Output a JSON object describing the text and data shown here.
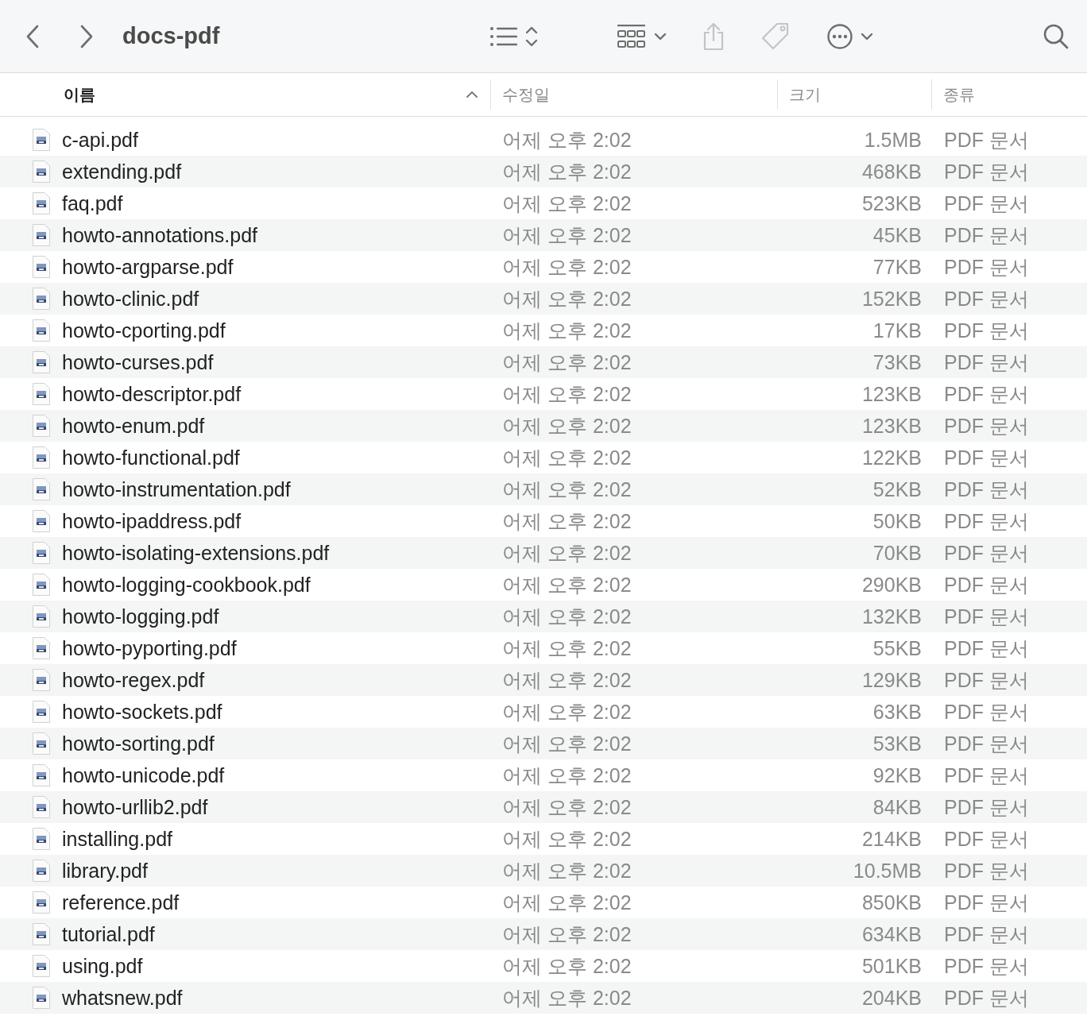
{
  "toolbar": {
    "title": "docs-pdf",
    "buttons": [
      {
        "kind": "back",
        "disabled": false
      },
      {
        "kind": "forward",
        "disabled": false
      },
      {
        "kind": "group",
        "disabled": false
      },
      {
        "kind": "view",
        "disabled": false
      },
      {
        "kind": "share",
        "disabled": true
      },
      {
        "kind": "tag",
        "disabled": true
      },
      {
        "kind": "more",
        "disabled": false
      },
      {
        "kind": "search",
        "disabled": false
      }
    ]
  },
  "table": {
    "columns": [
      {
        "label": "이름",
        "sorted": true
      },
      {
        "label": "수정일",
        "sorted": false
      },
      {
        "label": "크기",
        "sorted": false
      },
      {
        "label": "종류",
        "sorted": false
      }
    ],
    "rows": [
      {
        "name": "c-api.pdf",
        "modified": "어제 오후 2:02",
        "size": "1.5MB",
        "kind": "PDF 문서"
      },
      {
        "name": "extending.pdf",
        "modified": "어제 오후 2:02",
        "size": "468KB",
        "kind": "PDF 문서"
      },
      {
        "name": "faq.pdf",
        "modified": "어제 오후 2:02",
        "size": "523KB",
        "kind": "PDF 문서"
      },
      {
        "name": "howto-annotations.pdf",
        "modified": "어제 오후 2:02",
        "size": "45KB",
        "kind": "PDF 문서"
      },
      {
        "name": "howto-argparse.pdf",
        "modified": "어제 오후 2:02",
        "size": "77KB",
        "kind": "PDF 문서"
      },
      {
        "name": "howto-clinic.pdf",
        "modified": "어제 오후 2:02",
        "size": "152KB",
        "kind": "PDF 문서"
      },
      {
        "name": "howto-cporting.pdf",
        "modified": "어제 오후 2:02",
        "size": "17KB",
        "kind": "PDF 문서"
      },
      {
        "name": "howto-curses.pdf",
        "modified": "어제 오후 2:02",
        "size": "73KB",
        "kind": "PDF 문서"
      },
      {
        "name": "howto-descriptor.pdf",
        "modified": "어제 오후 2:02",
        "size": "123KB",
        "kind": "PDF 문서"
      },
      {
        "name": "howto-enum.pdf",
        "modified": "어제 오후 2:02",
        "size": "123KB",
        "kind": "PDF 문서"
      },
      {
        "name": "howto-functional.pdf",
        "modified": "어제 오후 2:02",
        "size": "122KB",
        "kind": "PDF 문서"
      },
      {
        "name": "howto-instrumentation.pdf",
        "modified": "어제 오후 2:02",
        "size": "52KB",
        "kind": "PDF 문서"
      },
      {
        "name": "howto-ipaddress.pdf",
        "modified": "어제 오후 2:02",
        "size": "50KB",
        "kind": "PDF 문서"
      },
      {
        "name": "howto-isolating-extensions.pdf",
        "modified": "어제 오후 2:02",
        "size": "70KB",
        "kind": "PDF 문서"
      },
      {
        "name": "howto-logging-cookbook.pdf",
        "modified": "어제 오후 2:02",
        "size": "290KB",
        "kind": "PDF 문서"
      },
      {
        "name": "howto-logging.pdf",
        "modified": "어제 오후 2:02",
        "size": "132KB",
        "kind": "PDF 문서"
      },
      {
        "name": "howto-pyporting.pdf",
        "modified": "어제 오후 2:02",
        "size": "55KB",
        "kind": "PDF 문서"
      },
      {
        "name": "howto-regex.pdf",
        "modified": "어제 오후 2:02",
        "size": "129KB",
        "kind": "PDF 문서"
      },
      {
        "name": "howto-sockets.pdf",
        "modified": "어제 오후 2:02",
        "size": "63KB",
        "kind": "PDF 문서"
      },
      {
        "name": "howto-sorting.pdf",
        "modified": "어제 오후 2:02",
        "size": "53KB",
        "kind": "PDF 문서"
      },
      {
        "name": "howto-unicode.pdf",
        "modified": "어제 오후 2:02",
        "size": "92KB",
        "kind": "PDF 문서"
      },
      {
        "name": "howto-urllib2.pdf",
        "modified": "어제 오후 2:02",
        "size": "84KB",
        "kind": "PDF 문서"
      },
      {
        "name": "installing.pdf",
        "modified": "어제 오후 2:02",
        "size": "214KB",
        "kind": "PDF 문서"
      },
      {
        "name": "library.pdf",
        "modified": "어제 오후 2:02",
        "size": "10.5MB",
        "kind": "PDF 문서"
      },
      {
        "name": "reference.pdf",
        "modified": "어제 오후 2:02",
        "size": "850KB",
        "kind": "PDF 문서"
      },
      {
        "name": "tutorial.pdf",
        "modified": "어제 오후 2:02",
        "size": "634KB",
        "kind": "PDF 문서"
      },
      {
        "name": "using.pdf",
        "modified": "어제 오후 2:02",
        "size": "501KB",
        "kind": "PDF 문서"
      },
      {
        "name": "whatsnew.pdf",
        "modified": "어제 오후 2:02",
        "size": "204KB",
        "kind": "PDF 문서"
      }
    ]
  }
}
